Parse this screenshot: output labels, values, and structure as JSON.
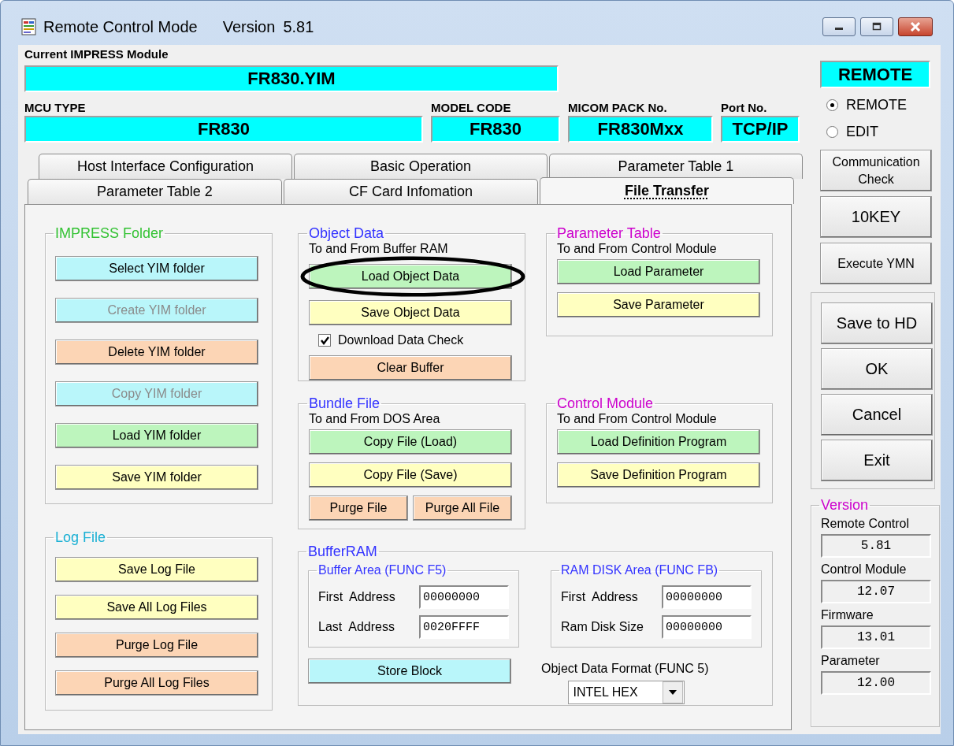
{
  "window": {
    "title": "Remote Control Mode",
    "version_label": "Version",
    "version": "5.81"
  },
  "module": {
    "label": "Current IMPRESS Module",
    "value": "FR830.YIM"
  },
  "info_fields": [
    {
      "label": "MCU TYPE",
      "value": "FR830"
    },
    {
      "label": "MODEL CODE",
      "value": "FR830"
    },
    {
      "label": "MICOM PACK No.",
      "value": "FR830Mxx"
    },
    {
      "label": "Port No.",
      "value": "TCP/IP"
    }
  ],
  "tab_rows": [
    {
      "tabs": [
        {
          "label": "Host Interface Configuration",
          "selected": false
        },
        {
          "label": "Basic Operation",
          "selected": false
        },
        {
          "label": "Parameter Table 1",
          "selected": false
        }
      ]
    },
    {
      "tabs": [
        {
          "label": "Parameter Table 2",
          "selected": false
        },
        {
          "label": "CF Card Infomation",
          "selected": false
        },
        {
          "label": "File Transfer",
          "selected": true
        }
      ]
    }
  ],
  "left_groups": [
    {
      "title": "IMPRESS Folder",
      "color": "#33c233",
      "items": [
        {
          "kind": "button",
          "label": "Select YIM folder",
          "color": "#b9f6fa",
          "disabled": false
        },
        {
          "kind": "button",
          "label": "Create YIM folder",
          "color": "#b9f6fa",
          "disabled": true
        },
        {
          "kind": "button",
          "label": "Delete YIM folder",
          "color": "#fcd5b5",
          "disabled": false
        },
        {
          "kind": "button",
          "label": "Copy YIM folder",
          "color": "#b9f6fa",
          "disabled": true
        },
        {
          "kind": "button",
          "label": "Load YIM folder",
          "color": "#bdf5bd",
          "disabled": false
        },
        {
          "kind": "button",
          "label": "Save YIM folder",
          "color": "#ffffc0",
          "disabled": false
        }
      ]
    },
    {
      "title": "Log File",
      "color": "#1ab0d4",
      "items": [
        {
          "kind": "button",
          "label": "Save Log File",
          "color": "#ffffc0",
          "disabled": false
        },
        {
          "kind": "button",
          "label": "Save All Log Files",
          "color": "#ffffc0",
          "disabled": false
        },
        {
          "kind": "button",
          "label": "Purge Log File",
          "color": "#fcd5b5",
          "disabled": false
        },
        {
          "kind": "button",
          "label": "Purge All Log Files",
          "color": "#fcd5b5",
          "disabled": false
        }
      ]
    }
  ],
  "center_groups": [
    {
      "title": "Object Data",
      "color": "#3333ff",
      "subtitle": "To and From Buffer RAM",
      "items": [
        {
          "kind": "button",
          "label": "Load Object Data",
          "color": "#bdf5bd",
          "disabled": false,
          "circled": true
        },
        {
          "kind": "button",
          "label": "Save Object Data",
          "color": "#ffffc0",
          "disabled": false
        },
        {
          "kind": "checkbox",
          "label": "Download Data Check",
          "checked": true
        },
        {
          "kind": "button",
          "label": "Clear Buffer",
          "color": "#fcd5b5",
          "disabled": false
        }
      ]
    },
    {
      "title": "Parameter Table",
      "color": "#cc00cc",
      "subtitle": "To and From Control Module",
      "items": [
        {
          "kind": "button",
          "label": "Load Parameter",
          "color": "#bdf5bd",
          "disabled": false
        },
        {
          "kind": "button",
          "label": "Save Parameter",
          "color": "#ffffc0",
          "disabled": false
        }
      ]
    },
    {
      "title": "Bundle File",
      "color": "#3333ff",
      "subtitle": "To and From DOS Area",
      "items": [
        {
          "kind": "button",
          "label": "Copy File (Load)",
          "color": "#bdf5bd",
          "disabled": false
        },
        {
          "kind": "button",
          "label": "Copy File (Save)",
          "color": "#ffffc0",
          "disabled": false
        },
        {
          "kind": "button_row",
          "buttons": [
            {
              "label": "Purge File",
              "color": "#fcd5b5",
              "disabled": false
            },
            {
              "label": "Purge All File",
              "color": "#fcd5b5",
              "disabled": false
            }
          ]
        }
      ]
    },
    {
      "title": "Control Module",
      "color": "#cc00cc",
      "subtitle": "To and From Control Module",
      "items": [
        {
          "kind": "button",
          "label": "Load Definition Program",
          "color": "#bdf5bd",
          "disabled": false
        },
        {
          "kind": "button",
          "label": "Save Definition Program",
          "color": "#ffffc0",
          "disabled": false
        }
      ]
    }
  ],
  "buffer_ram": {
    "title": "BufferRAM",
    "color": "#3333ff",
    "areas": [
      {
        "title": "Buffer Area (FUNC F5)",
        "color": "#3333ff",
        "fields": [
          {
            "label": "First  Address",
            "value": "00000000"
          },
          {
            "label": "Last  Address",
            "value": "0020FFFF"
          }
        ]
      },
      {
        "title": "RAM DISK Area (FUNC FB)",
        "color": "#3333ff",
        "fields": [
          {
            "label": "First  Address",
            "value": "00000000"
          },
          {
            "label": "Ram Disk Size",
            "value": "00000000"
          }
        ]
      }
    ],
    "store_button": {
      "label": "Store Block",
      "color": "#b9f6fa"
    },
    "format_label": "Object Data Format (FUNC 5)",
    "format_value": "INTEL HEX"
  },
  "mode_indicator": "REMOTE",
  "mode_options": [
    {
      "label": "REMOTE",
      "selected": true
    },
    {
      "label": "EDIT",
      "selected": false
    }
  ],
  "side_buttons": [
    "Communication\nCheck",
    "10KEY",
    "Execute YMN"
  ],
  "action_buttons": [
    "Save to HD",
    "OK",
    "Cancel",
    "Exit"
  ],
  "version_panel": {
    "title": "Version",
    "color": "#cc00cc",
    "items": [
      {
        "label": "Remote Control",
        "value": "5.81"
      },
      {
        "label": "Control Module",
        "value": "12.07"
      },
      {
        "label": "Firmware",
        "value": "13.01"
      },
      {
        "label": "Parameter",
        "value": "12.00"
      }
    ]
  }
}
